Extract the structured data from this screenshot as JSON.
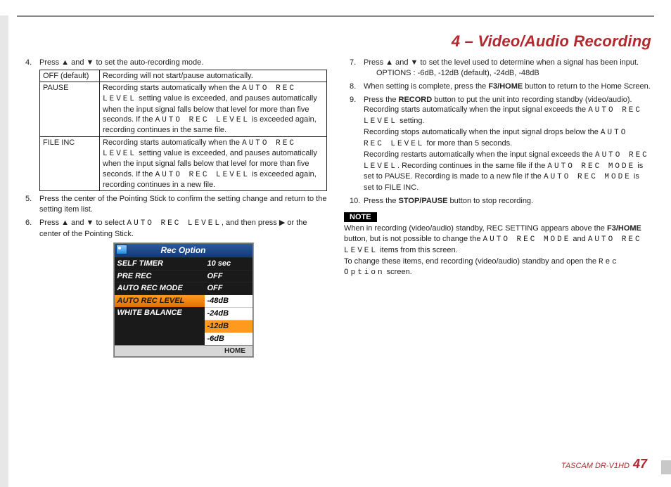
{
  "header": {
    "title": "4 – Video/Audio Recording"
  },
  "left": {
    "step4_intro": "Press ▲ and ▼ to set the auto-recording mode.",
    "table": {
      "r1c1": "OFF (default)",
      "r1c2": "Recording will not start/pause automatically.",
      "r2c1": "PAUSE",
      "r2c2a": "Recording starts automatically when the ",
      "r2c2b": " setting value is exceeded, and pauses automatically when the input signal falls below that level for more than five seconds. If the ",
      "r2c2c": " is exceeded again, recording continues in the same file.",
      "r3c1": "FILE INC",
      "r3c2a": "Recording starts automatically when the ",
      "r3c2b": " setting value is exceeded, and pauses automatically when the input signal falls below that level for more than five seconds. If the ",
      "r3c2c": " is exceeded again, recording continues in a new file.",
      "lcd": "AUTO REC LEVEL"
    },
    "step5": "Press the center of the Pointing Stick to confirm the setting change and return to the setting item list.",
    "step6a": "Press ▲ and ▼ to select ",
    "step6b": ", and then press ▶ or the center of the Pointing Stick.",
    "device": {
      "title": "Rec Option",
      "rows": [
        {
          "l": "SELF TIMER",
          "r": "10 sec"
        },
        {
          "l": "PRE REC",
          "r": "OFF"
        },
        {
          "l": "AUTO REC MODE",
          "r": "OFF"
        },
        {
          "l": "AUTO REC LEVEL",
          "r": "-48dB",
          "sel": true
        }
      ],
      "subs": [
        "-24dB",
        "-12dB",
        "-6dB"
      ],
      "sub_hl_index": 1,
      "white_balance": "WHITE BALANCE",
      "footer": [
        "",
        "",
        "",
        "HOME"
      ]
    }
  },
  "right": {
    "step7": "Press ▲ and ▼ to set the level used to determine when a signal has been input.",
    "step7_opts": "OPTIONS : -6dB, -12dB (default), -24dB, -48dB",
    "step8a": "When setting is complete, press the ",
    "step8b": " button to return to the Home Screen.",
    "f3home": "F3/HOME",
    "step9a": "Press the ",
    "record": "RECORD",
    "step9b": " button to put the unit into recording standby (video/audio). Recording starts automatically when the input signal exceeds the ",
    "step9c": " setting.",
    "step9d": "Recording stops automatically when the input signal drops below the ",
    "step9e": " for more than 5 seconds.",
    "step9f": "Recording restarts automatically when the input signal exceeds the ",
    "step9g": ". Recording continues in the same file if the ",
    "step9h": " is set to PAUSE. Recording is made to a new file if the ",
    "step9i": " is set to FILE INC.",
    "arl": "AUTO REC LEVEL",
    "arm": "AUTO REC MODE",
    "step10a": "Press the ",
    "stoppause": "STOP/PAUSE",
    "step10b": " button to stop recording.",
    "note_label": "NOTE",
    "note1a": "When in recording (video/audio) standby, REC SETTING appears above the ",
    "note1b": " button, but is not possible to change the ",
    "note1c": " and ",
    "note1d": " items from this screen.",
    "note2a": "To change these items, end recording (video/audio) standby and open the ",
    "note2b": " screen.",
    "recopt": "Rec Option"
  },
  "footer": {
    "model": "TASCAM  DR-V1HD",
    "page": "47"
  }
}
